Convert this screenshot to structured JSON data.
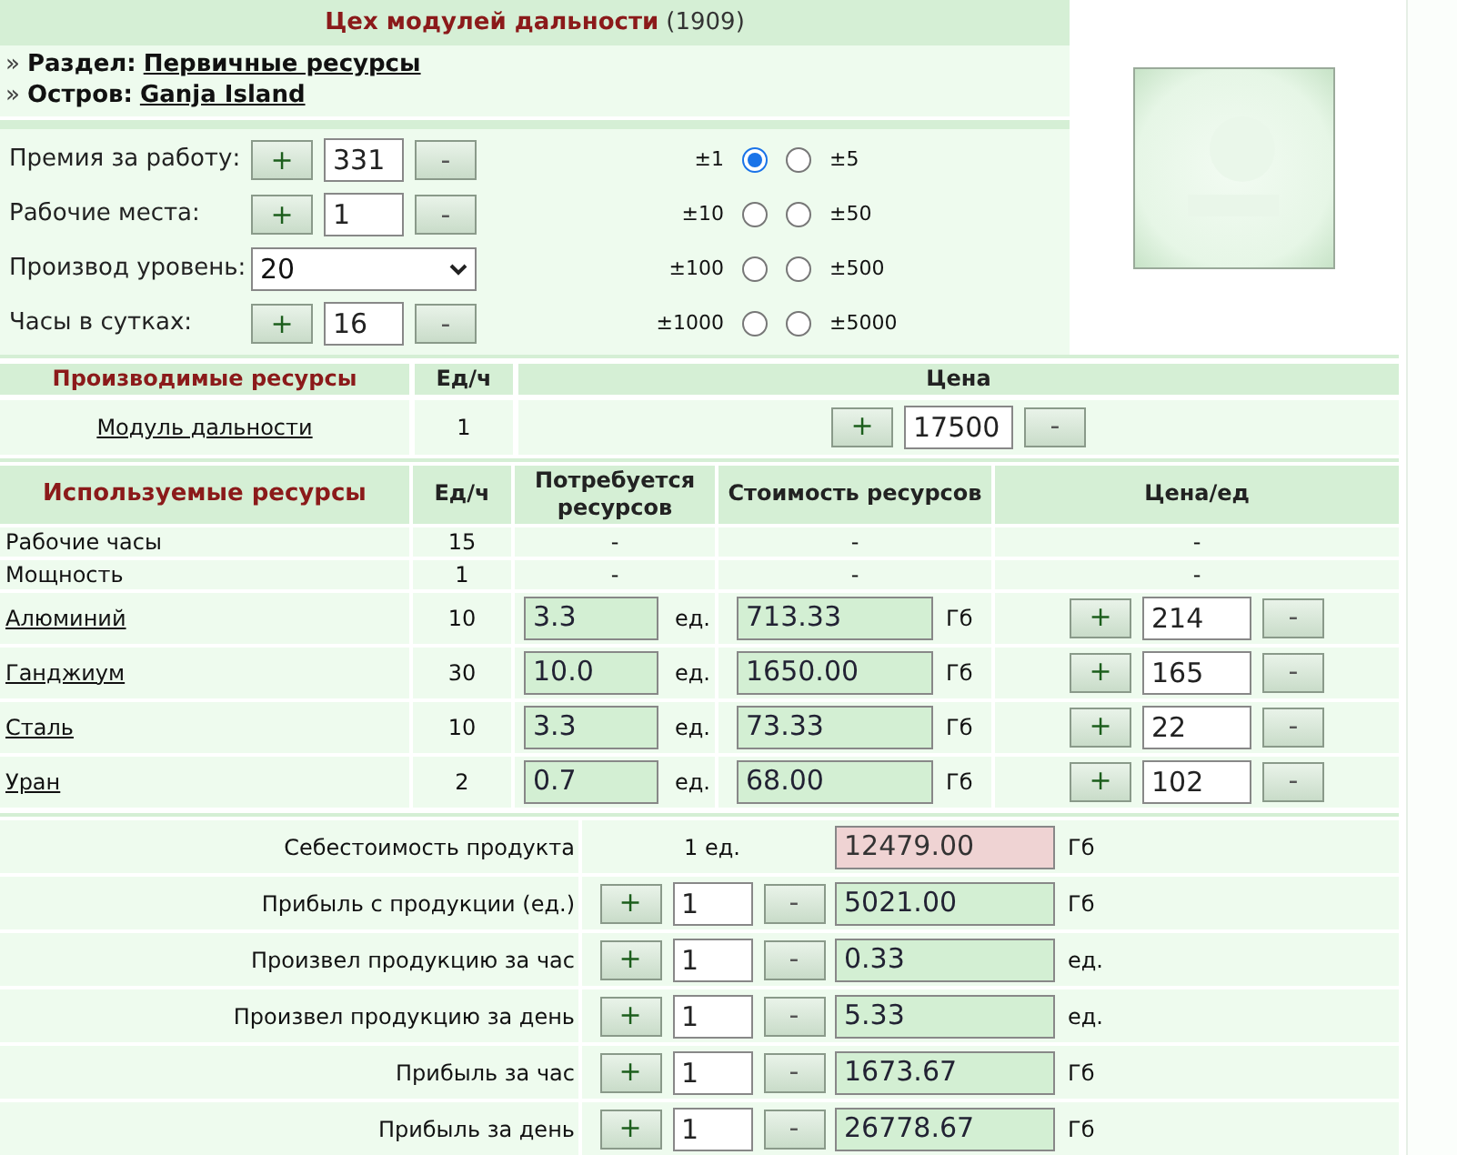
{
  "title": {
    "name": "Цех модулей дальности",
    "number": "(1909)"
  },
  "breadcrumbs": [
    {
      "bullet": "»",
      "label": "Раздел:",
      "value": "Первичные ресурсы"
    },
    {
      "bullet": "»",
      "label": "Остров:",
      "value": "Ganja Island"
    }
  ],
  "settings": [
    {
      "kind": "stepper",
      "label": "Премия за работу:",
      "plus": "+",
      "value": "331",
      "minus": "-"
    },
    {
      "kind": "stepper",
      "label": "Рабочие места:",
      "plus": "+",
      "value": "1",
      "minus": "-"
    },
    {
      "kind": "select",
      "label": "Производ уровень:",
      "value": "20"
    },
    {
      "kind": "stepper",
      "label": "Часы в сутках:",
      "plus": "+",
      "value": "16",
      "minus": "-"
    }
  ],
  "step_rows": [
    {
      "left": {
        "label": "±1",
        "selected": true
      },
      "right": {
        "label": "±5",
        "selected": false
      }
    },
    {
      "left": {
        "label": "±10",
        "selected": false
      },
      "right": {
        "label": "±50",
        "selected": false
      }
    },
    {
      "left": {
        "label": "±100",
        "selected": false
      },
      "right": {
        "label": "±500",
        "selected": false
      }
    },
    {
      "left": {
        "label": "±1000",
        "selected": false
      },
      "right": {
        "label": "±5000",
        "selected": false
      }
    }
  ],
  "produced": {
    "columns": [
      "Производимые ресурсы",
      "Ед/ч",
      "Цена"
    ],
    "rows": [
      {
        "name": "Модуль дальности",
        "per_hour": "1",
        "plus": "+",
        "price": "17500",
        "minus": "-"
      }
    ]
  },
  "used": {
    "columns": [
      "Используемые ресурсы",
      "Ед/ч",
      "Потребуется ресурсов",
      "Стоимость ресурсов",
      "Цена/ед"
    ],
    "rows": [
      {
        "kind": "plain",
        "name": "Рабочие часы",
        "per_hour": "15",
        "needed": "-",
        "cost": "-",
        "price": "-"
      },
      {
        "kind": "plain",
        "name": "Мощность",
        "per_hour": "1",
        "needed": "-",
        "cost": "-",
        "price": "-"
      },
      {
        "kind": "resource",
        "name": "Алюминий",
        "per_hour": "10",
        "needed": "3.3",
        "needed_unit": "ед.",
        "cost": "713.33",
        "cost_unit": "Гб",
        "plus": "+",
        "price": "214",
        "minus": "-"
      },
      {
        "kind": "resource",
        "name": "Ганджиум",
        "per_hour": "30",
        "needed": "10.0",
        "needed_unit": "ед.",
        "cost": "1650.00",
        "cost_unit": "Гб",
        "plus": "+",
        "price": "165",
        "minus": "-"
      },
      {
        "kind": "resource",
        "name": "Сталь",
        "per_hour": "10",
        "needed": "3.3",
        "needed_unit": "ед.",
        "cost": "73.33",
        "cost_unit": "Гб",
        "plus": "+",
        "price": "22",
        "minus": "-"
      },
      {
        "kind": "resource",
        "name": "Уран",
        "per_hour": "2",
        "needed": "0.7",
        "needed_unit": "ед.",
        "cost": "68.00",
        "cost_unit": "Гб",
        "plus": "+",
        "price": "102",
        "minus": "-"
      }
    ]
  },
  "summary": [
    {
      "kind": "cost",
      "label": "Себестоимость продукта",
      "quantity": "1 ед.",
      "value": "12479.00",
      "unit": "Гб"
    },
    {
      "kind": "stepper",
      "label": "Прибыль с продукции (ед.)",
      "plus": "+",
      "amount": "1",
      "minus": "-",
      "value": "5021.00",
      "unit": "Гб"
    },
    {
      "kind": "stepper",
      "label": "Произвел продукцию за час",
      "plus": "+",
      "amount": "1",
      "minus": "-",
      "value": "0.33",
      "unit": "ед."
    },
    {
      "kind": "stepper",
      "label": "Произвел продукцию за день",
      "plus": "+",
      "amount": "1",
      "minus": "-",
      "value": "5.33",
      "unit": "ед."
    },
    {
      "kind": "stepper",
      "label": "Прибыль за час",
      "plus": "+",
      "amount": "1",
      "minus": "-",
      "value": "1673.67",
      "unit": "Гб"
    },
    {
      "kind": "stepper",
      "label": "Прибыль за день",
      "plus": "+",
      "amount": "1",
      "minus": "-",
      "value": "26778.67",
      "unit": "Гб"
    }
  ]
}
